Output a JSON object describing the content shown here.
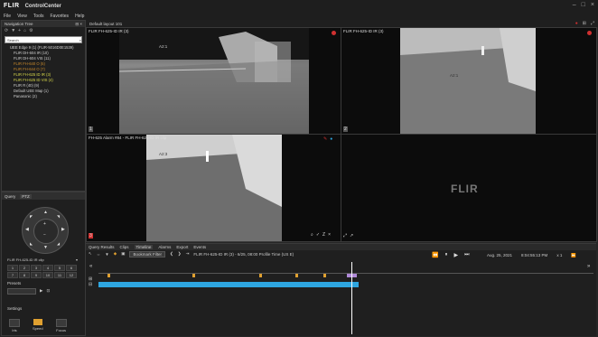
{
  "app": {
    "logo": "FLIR",
    "title": "ControlCenter"
  },
  "menu": [
    "File",
    "View",
    "Tools",
    "Favorites",
    "Help"
  ],
  "window_controls": [
    "–",
    "□",
    "×"
  ],
  "nav_panel": {
    "title": "Navigation Tree",
    "search": "Search",
    "tree": [
      {
        "label": "UEE Edge 9 (1) (FLIR-5016D0E1539)",
        "cls": "",
        "indent": "sub"
      },
      {
        "label": "FLIR DH-604 IR (10)",
        "cls": "",
        "indent": "cam"
      },
      {
        "label": "FLIR DH-604 VIS (11)",
        "cls": "",
        "indent": "cam"
      },
      {
        "label": "FLIR FH-640 O (5)",
        "cls": "dim",
        "indent": "cam"
      },
      {
        "label": "FLIR FH-644 O (7)",
        "cls": "dim",
        "indent": "cam"
      },
      {
        "label": "FLIR FH-625 ID IR (3)",
        "cls": "active",
        "indent": "cam"
      },
      {
        "label": "FLIR FH-625 ID VIS (4)",
        "cls": "active",
        "indent": "cam"
      },
      {
        "label": "FLIR R (40) (9)",
        "cls": "",
        "indent": "cam"
      },
      {
        "label": "Default UEE Map (1)",
        "cls": "",
        "indent": "cam"
      },
      {
        "label": "Panasonic (2)",
        "cls": "",
        "indent": "cam"
      }
    ]
  },
  "ptz_panel": {
    "tabs": [
      "Query",
      "PTZ"
    ],
    "selected_camera": "FLIR FH-625-ID IR clip",
    "numbers": [
      "1",
      "2",
      "3",
      "4",
      "5",
      "6",
      "7",
      "8",
      "9",
      "10",
      "11",
      "12"
    ],
    "presets_label": "Presets",
    "settings_label": "Settings",
    "controls": [
      {
        "label": "Iris",
        "active": false
      },
      {
        "label": "Speed",
        "active": true
      },
      {
        "label": "Focus",
        "active": false
      }
    ]
  },
  "video": {
    "layout_title": "Default layout 101",
    "tiles": [
      {
        "label": "FLIR FH-625-ID IR (3)"
      },
      {
        "label": "FLIR FH-625-ID IR (3)"
      },
      {
        "label": "FH-625 Alarm #84 - FLIR FH-625-ID IR clip"
      },
      {
        "label": ""
      }
    ],
    "target_label_1": "A2:1",
    "target_label_2": "A2:1",
    "target_label_3": "A2:3",
    "watermark": "FLIR"
  },
  "bottom": {
    "tabs": [
      "Query Results",
      "Clips",
      "Timeline",
      "Alarms",
      "Export",
      "Events"
    ],
    "selected_tab": "Timeline",
    "bookmark_btn": "Bookmark Filter",
    "clip_info": "FLIR FH-625-ID IR (3) - 6/25, 08:00 Profile Time (US E)",
    "date": "Aug. 25, 2021",
    "time": "8:04:55:13 PM",
    "speed": "x 1"
  },
  "colors": {
    "accent": "#e0a030",
    "timeline": "#2ea6e0",
    "record": "#d03030"
  }
}
